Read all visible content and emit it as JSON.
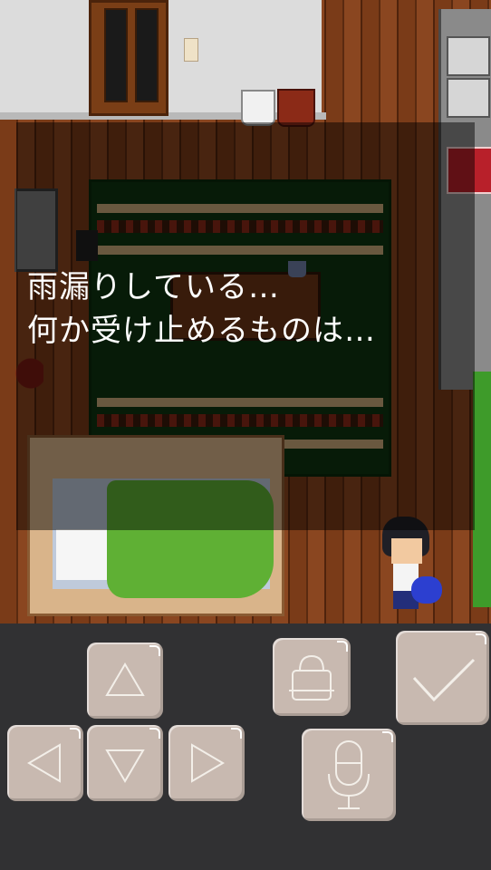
{
  "dialog": {
    "line1": "雨漏りしている…",
    "line2": "何か受け止めるものは…"
  },
  "controls": {
    "dpad": [
      "up-arrow-icon",
      "left-arrow-icon",
      "down-arrow-icon",
      "right-arrow-icon"
    ],
    "action_icons": [
      "bag-icon",
      "microphone-icon",
      "checkmark-icon"
    ]
  },
  "colors": {
    "panel_bg": "#313133",
    "button_bg": "#c8b9b0",
    "dialog_text": "#ffffff"
  }
}
